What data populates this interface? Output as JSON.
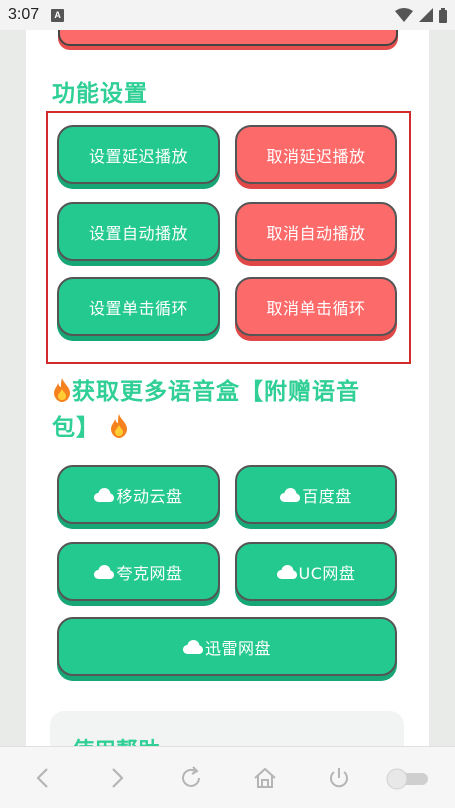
{
  "status_bar": {
    "time": "3:07",
    "badge": "A"
  },
  "function_settings": {
    "title": "功能设置",
    "buttons": {
      "set_delay": "设置延迟播放",
      "cancel_delay": "取消延迟播放",
      "set_auto": "设置自动播放",
      "cancel_auto": "取消自动播放",
      "set_loop": "设置单击循环",
      "cancel_loop": "取消单击循环"
    }
  },
  "promo": {
    "title": "获取更多语音盒【附赠语音包】"
  },
  "downloads": {
    "mobile_cloud": "移动云盘",
    "baidu": "百度盘",
    "quark": "夸克网盘",
    "uc": "UC网盘",
    "xunlei": "迅雷网盘"
  },
  "help": {
    "title": "使用帮助"
  },
  "colors": {
    "accent": "#2fcf96",
    "green_button": "#23c98f",
    "red_button": "#fd6a6a",
    "highlight": "#d12b2b"
  }
}
